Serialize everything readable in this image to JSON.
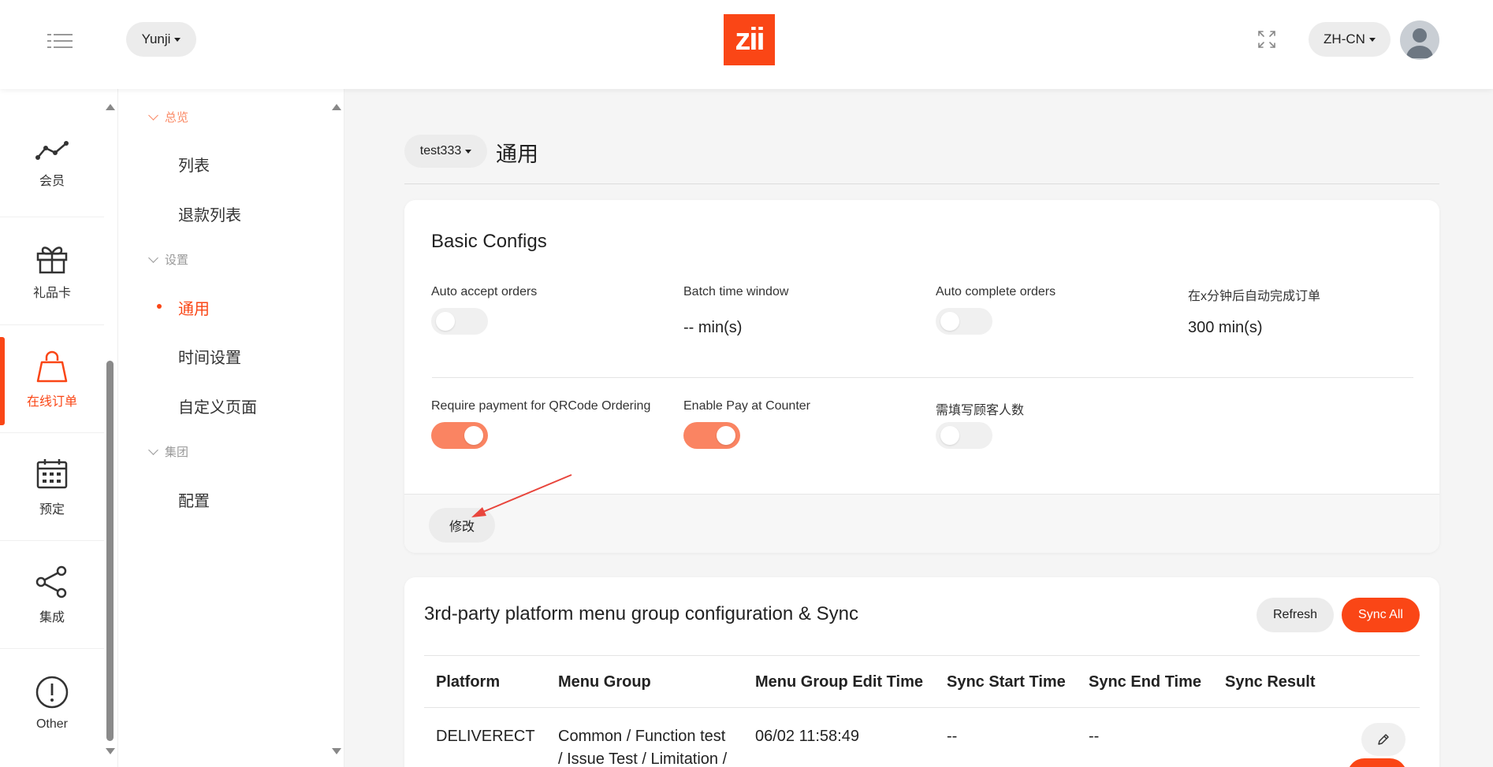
{
  "header": {
    "store_selector": "Yunji",
    "logo_text": "zii",
    "language": "ZH-CN",
    "brand_color": "#fa4616"
  },
  "sidebar_primary": {
    "items": [
      {
        "label": "会员",
        "icon": "trend-line-icon"
      },
      {
        "label": "礼品卡",
        "icon": "gift-icon"
      },
      {
        "label": "在线订单",
        "icon": "shopping-bag-icon",
        "active": true
      },
      {
        "label": "预定",
        "icon": "calendar-icon"
      },
      {
        "label": "集成",
        "icon": "share-icon"
      },
      {
        "label": "Other",
        "icon": "info-circle-icon"
      }
    ]
  },
  "sidebar_secondary": {
    "groups": [
      {
        "label": "总览",
        "items": [
          "列表",
          "退款列表"
        ]
      },
      {
        "label": "设置",
        "items": [
          "通用",
          "时间设置",
          "自定义页面"
        ]
      },
      {
        "label": "集团",
        "items": [
          "配置"
        ]
      }
    ],
    "active_item": "通用"
  },
  "page": {
    "store_selector": "test333",
    "title": "通用"
  },
  "basic_configs": {
    "title": "Basic Configs",
    "auto_accept_orders": {
      "label": "Auto accept orders",
      "enabled": false
    },
    "batch_time_window": {
      "label": "Batch time window",
      "value": "-- min(s)"
    },
    "auto_complete_orders": {
      "label": "Auto complete orders",
      "enabled": false
    },
    "auto_complete_after": {
      "label": "在x分钟后自动完成订单",
      "value": "300 min(s)"
    },
    "require_payment_qr": {
      "label": "Require payment for QRCode Ordering",
      "enabled": true
    },
    "enable_pay_counter": {
      "label": "Enable Pay at Counter",
      "enabled": true
    },
    "require_guest_count": {
      "label": "需填写顾客人数",
      "enabled": false
    },
    "modify_label": "修改"
  },
  "menu_sync": {
    "title": "3rd-party platform menu group configuration & Sync",
    "refresh_label": "Refresh",
    "sync_all_label": "Sync All",
    "columns": [
      "Platform",
      "Menu Group",
      "Menu Group Edit Time",
      "Sync Start Time",
      "Sync End Time",
      "Sync Result"
    ],
    "rows": [
      {
        "platform": "DELIVERECT",
        "menu_group_line1": "Common / Function test",
        "menu_group_line2": "/ Issue Test / Limitation /",
        "edit_time": "06/02 11:58:49",
        "sync_start": "--",
        "sync_end": "--",
        "sync_result": ""
      }
    ]
  }
}
